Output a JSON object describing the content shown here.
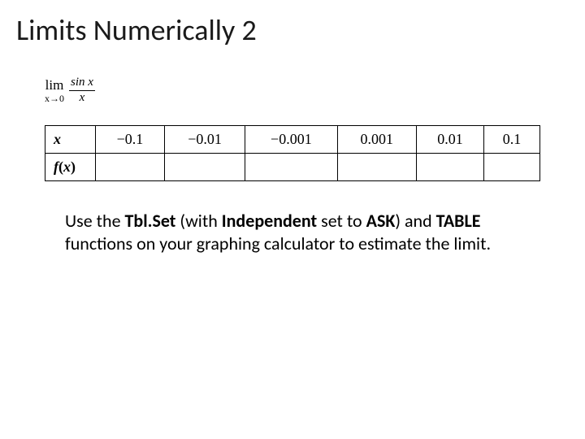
{
  "title": "Limits Numerically 2",
  "limit": {
    "lim": "lim",
    "approach": "x→0",
    "numerator": "sin x",
    "denominator": "x"
  },
  "table": {
    "row1_label": "x",
    "row2_label_f": "f",
    "row2_label_open": "(",
    "row2_label_x": "x",
    "row2_label_close": ")",
    "values": [
      "−0.1",
      "−0.01",
      "−0.001",
      "0.001",
      "0.01",
      "0.1"
    ],
    "fvalues": [
      "",
      "",
      "",
      "",
      "",
      ""
    ]
  },
  "instructions": {
    "pre1": "Use the ",
    "b1": "Tbl.Set",
    "mid1": " (with ",
    "b2": "Independent",
    "mid2": " set to ",
    "b3": "ASK",
    "mid3": ") and ",
    "b4": "TABLE",
    "post": " functions on your graphing calculator to estimate the limit."
  }
}
